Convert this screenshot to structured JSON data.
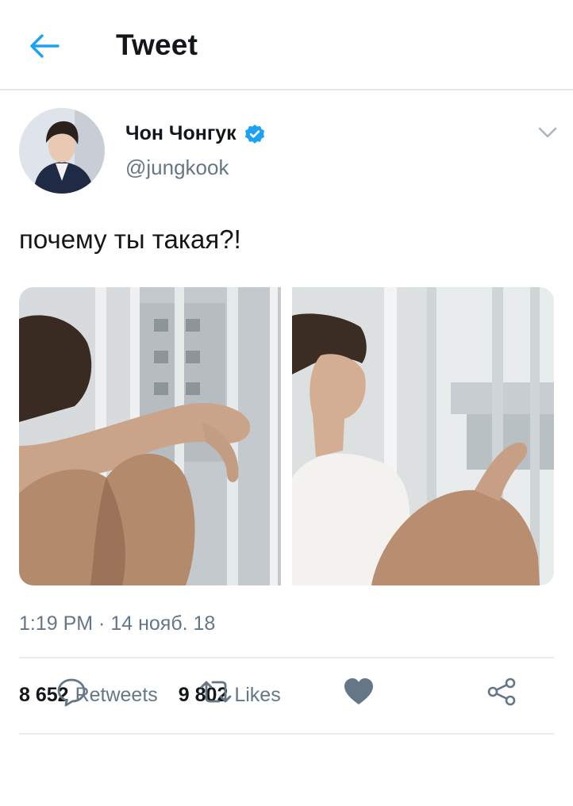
{
  "header": {
    "title": "Tweet",
    "back_icon": "arrow-left-icon"
  },
  "tweet": {
    "author": {
      "display_name": "Чон Чонгук",
      "handle": "@jungkook",
      "verified": true,
      "avatar_icon": "avatar-photo"
    },
    "text": "почему ты такая?!",
    "media": [
      {
        "kind": "photo",
        "description_icon": "photo-1"
      },
      {
        "kind": "photo",
        "description_icon": "photo-2"
      }
    ],
    "timestamp": "1:19 PM · 14 нояб. 18",
    "stats": {
      "retweets_count": "8 652",
      "retweets_label": "Retweets",
      "likes_count": "9 802",
      "likes_label": "Likes"
    }
  },
  "actions": [
    "reply-icon",
    "retweet-icon",
    "like-icon",
    "share-icon"
  ],
  "colors": {
    "accent": "#1da1f2",
    "text": "#14171a",
    "secondary": "#657786",
    "divider": "#e6ecf0",
    "action_icon": "#657786"
  }
}
